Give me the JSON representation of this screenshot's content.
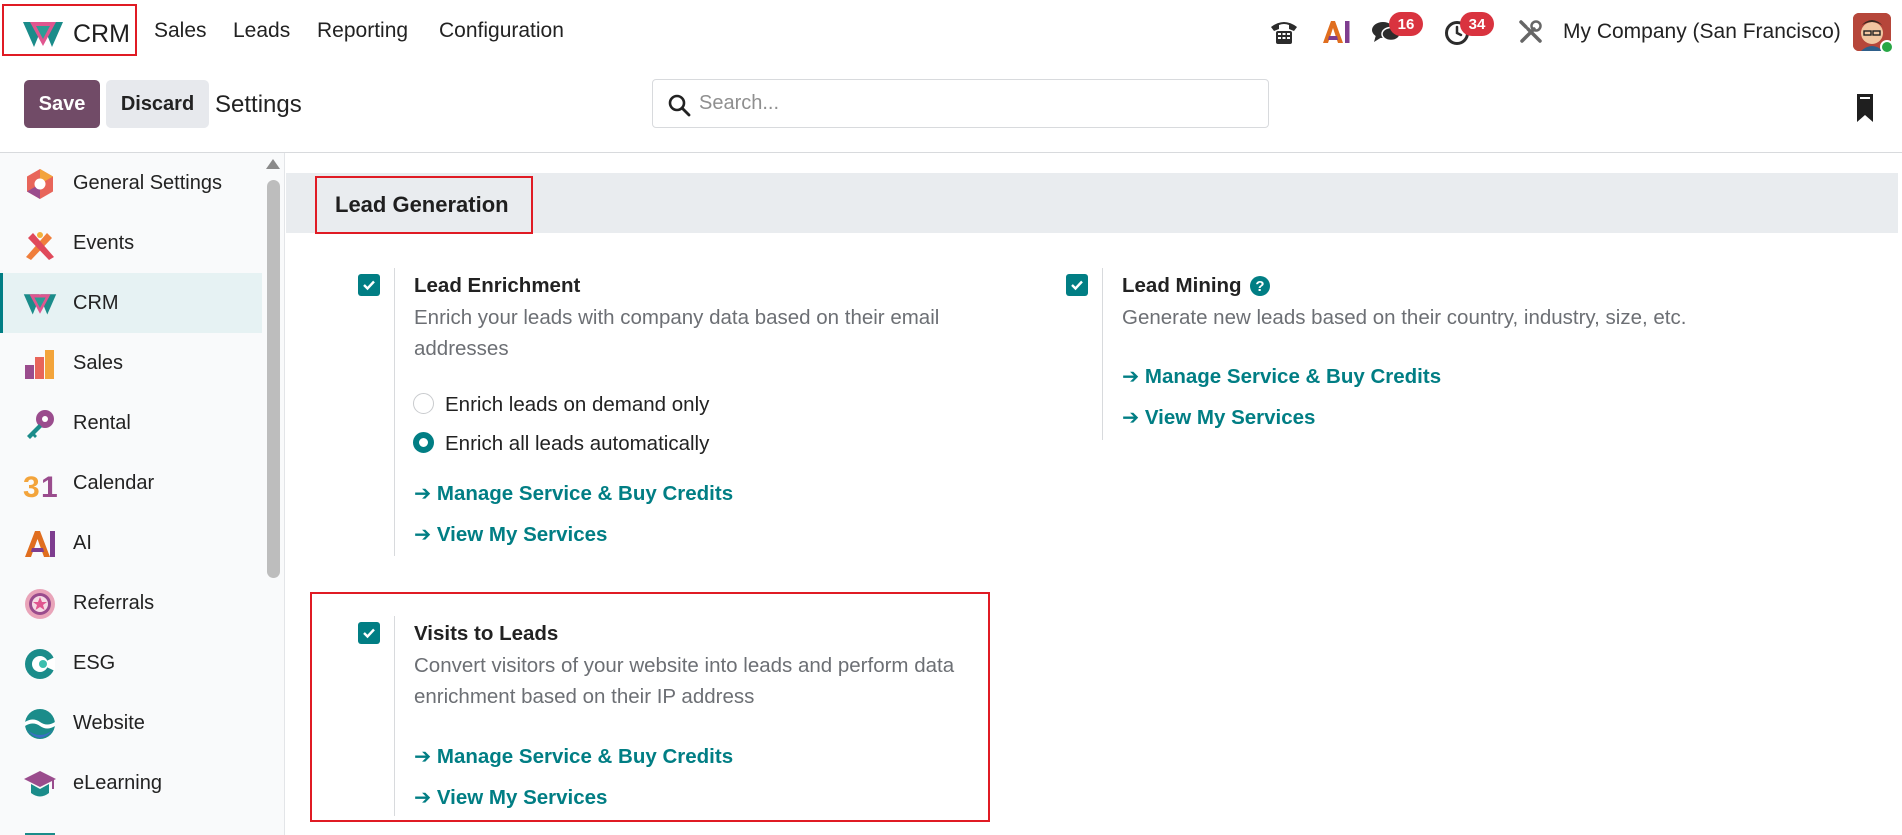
{
  "navbar": {
    "app_name": "CRM",
    "menu": [
      "Sales",
      "Leads",
      "Reporting",
      "Configuration"
    ],
    "messages_count": "16",
    "activities_count": "34",
    "company": "My Company (San Francisco)"
  },
  "control": {
    "save_label": "Save",
    "discard_label": "Discard",
    "title": "Settings",
    "search_placeholder": "Search..."
  },
  "sidebar": {
    "items": [
      {
        "label": "General Settings",
        "icon": "general-settings-icon"
      },
      {
        "label": "Events",
        "icon": "events-icon"
      },
      {
        "label": "CRM",
        "icon": "crm-icon",
        "active": true
      },
      {
        "label": "Sales",
        "icon": "sales-icon"
      },
      {
        "label": "Rental",
        "icon": "rental-icon"
      },
      {
        "label": "Calendar",
        "icon": "calendar-icon"
      },
      {
        "label": "AI",
        "icon": "ai-icon"
      },
      {
        "label": "Referrals",
        "icon": "referrals-icon"
      },
      {
        "label": "ESG",
        "icon": "esg-icon"
      },
      {
        "label": "Website",
        "icon": "website-icon"
      },
      {
        "label": "eLearning",
        "icon": "elearning-icon"
      }
    ]
  },
  "section": {
    "title": "Lead Generation"
  },
  "lead_enrichment": {
    "title": "Lead Enrichment",
    "desc_line1": "Enrich your leads with company data based on their email",
    "desc_line2": "addresses",
    "option_demand": "Enrich leads on demand only",
    "option_auto": "Enrich all leads automatically",
    "link_credits": "➔ Manage Service & Buy Credits",
    "link_services": "➔ View My Services"
  },
  "lead_mining": {
    "title": "Lead Mining",
    "desc": "Generate new leads based on their country, industry, size, etc.",
    "link_credits": "➔ Manage Service & Buy Credits",
    "link_services": "➔ View My Services"
  },
  "visits_to_leads": {
    "title": "Visits to Leads",
    "desc_line1": "Convert visitors of your website into leads and perform data",
    "desc_line2": "enrichment based on their IP address",
    "link_credits": "➔ Manage Service & Buy Credits",
    "link_services": "➔ View My Services"
  },
  "colors": {
    "primary": "#714b67",
    "accent": "#017e84",
    "badge": "#d9333f",
    "highlight": "#e01b24"
  }
}
